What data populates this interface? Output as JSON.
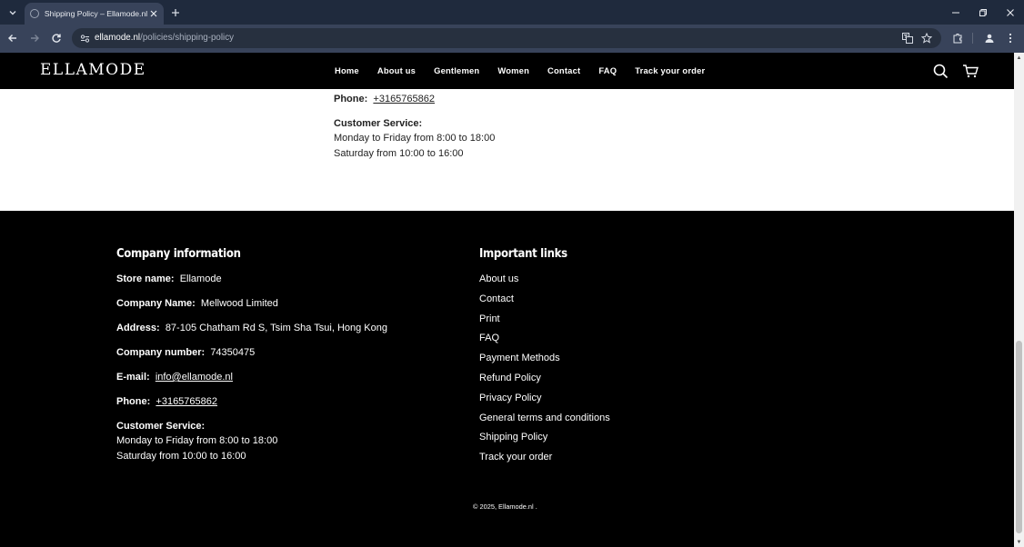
{
  "browser": {
    "tab_title": "Shipping Policy – Ellamode.nl",
    "url_host": "ellamode.nl",
    "url_path": "/policies/shipping-policy"
  },
  "header": {
    "logo": "ELLAMODE",
    "nav": [
      "Home",
      "About us",
      "Gentlemen",
      "Women",
      "Contact",
      "FAQ",
      "Track your order"
    ]
  },
  "content": {
    "phone_label": "Phone:",
    "phone_value": "+3165765862",
    "service_label": "Customer Service:",
    "service_line1": "Monday to Friday from 8:00 to 18:00",
    "service_line2": "Saturday from 10:00 to 16:00"
  },
  "footer": {
    "company_heading": "Company information",
    "links_heading": "Important links",
    "store_name_label": "Store name:",
    "store_name_value": "Ellamode",
    "company_name_label": "Company Name:",
    "company_name_value": "Mellwood Limited",
    "address_label": "Address:",
    "address_value": "87-105 Chatham Rd S, Tsim Sha Tsui, Hong Kong",
    "company_number_label": "Company number:",
    "company_number_value": "74350475",
    "email_label": "E-mail:",
    "email_value": "info@ellamode.nl",
    "phone_label": "Phone:",
    "phone_value": "+3165765862",
    "service_label": "Customer Service:",
    "service_line1": "Monday to Friday from 8:00 to 18:00",
    "service_line2": "Saturday from 10:00 to 16:00",
    "links": [
      "About us",
      "Contact",
      "Print",
      "FAQ",
      "Payment Methods",
      "Refund Policy",
      "Privacy Policy",
      "General terms and conditions",
      "Shipping Policy",
      "Track your order"
    ],
    "copyright": "© 2025, Ellamode.nl ."
  }
}
